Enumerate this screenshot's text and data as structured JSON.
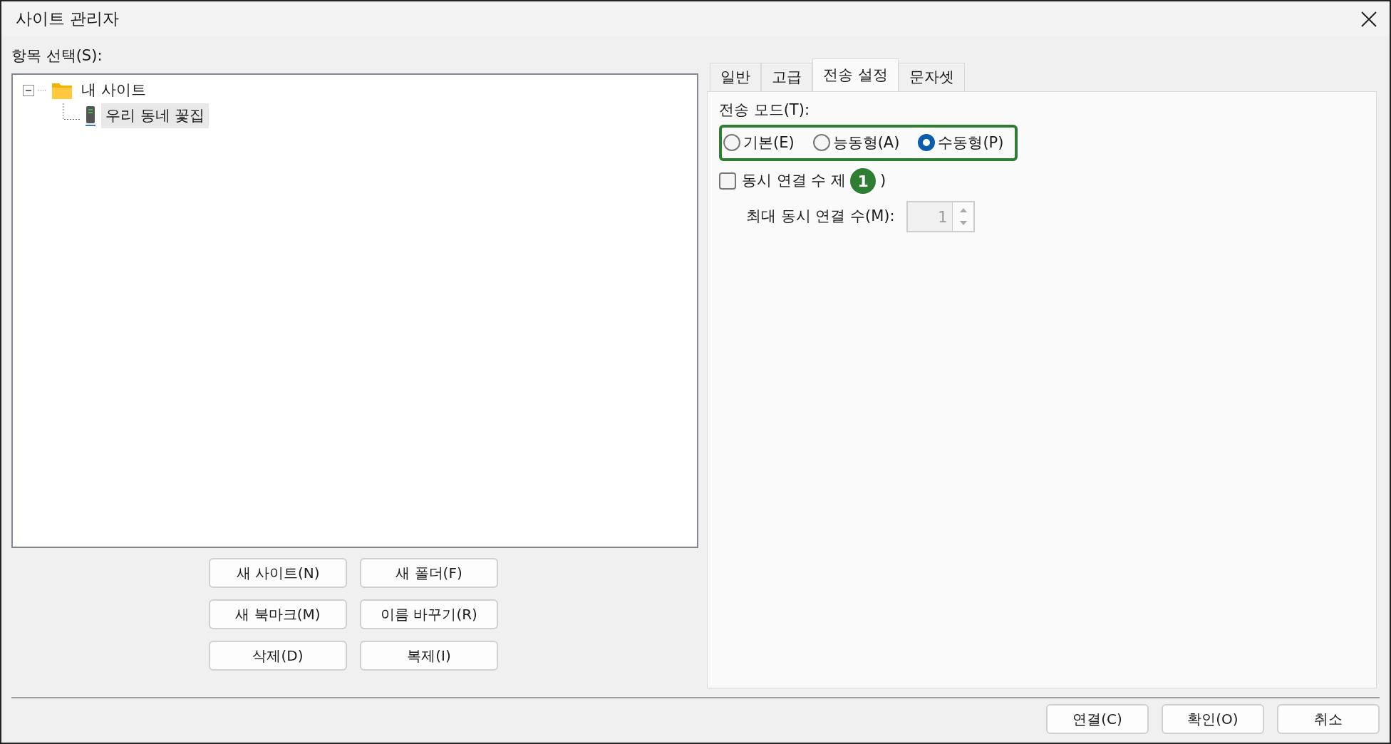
{
  "window": {
    "title": "사이트 관리자"
  },
  "tree": {
    "label": "항목 선택(S):",
    "items": [
      {
        "kind": "folder",
        "label": "내 사이트",
        "expanded": true,
        "selected": false,
        "children": [
          {
            "kind": "site",
            "label": "우리 동네 꽃집",
            "selected": true
          }
        ]
      }
    ]
  },
  "site_buttons": [
    "새 사이트(N)",
    "새 폴더(F)",
    "새 북마크(M)",
    "이름 바꾸기(R)",
    "삭제(D)",
    "복제(I)"
  ],
  "tabs": [
    {
      "label": "일반",
      "selected": false
    },
    {
      "label": "고급",
      "selected": false
    },
    {
      "label": "전송 설정",
      "selected": true
    },
    {
      "label": "문자셋",
      "selected": false
    }
  ],
  "transfer_mode": {
    "label": "전송 모드(T):",
    "highlighted": true,
    "options": [
      {
        "label": "기본(E)",
        "selected": false
      },
      {
        "label": "능동형(A)",
        "selected": false
      },
      {
        "label": "수동형(P)",
        "selected": true
      }
    ]
  },
  "limit": {
    "label": "동시 연결 수 제",
    "label_tail": ")",
    "checked": false,
    "max_label": "최대 동시 연결 수(M):",
    "max_value": "1",
    "disabled": true
  },
  "callout": {
    "text": "1"
  },
  "footer_buttons": [
    "연결(C)",
    "확인(O)",
    "취소"
  ]
}
